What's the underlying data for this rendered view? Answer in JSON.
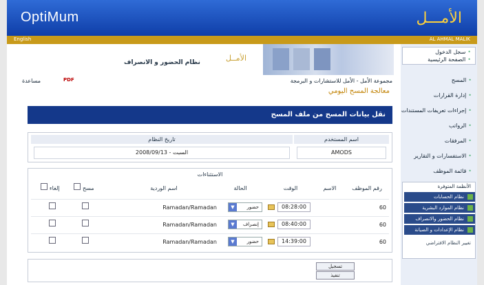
{
  "header": {
    "brand": "OptiMum",
    "logo_ar": "الأمـــل",
    "language_link": "English",
    "user": "AL AHMAL MALIK"
  },
  "hero": {
    "system_title": "نظام الحضور و الانصراف",
    "logo_small": "الأمــل"
  },
  "toolbar": {
    "help": "مساعدة",
    "pdf": "PDF",
    "breadcrumb": "مجموعة الأمل - الأمل للاستشارات و البرمجة"
  },
  "page": {
    "title": "معالجة المسح اليومي",
    "section_title": "نقل بيانات المسح من ملف المسح"
  },
  "info": {
    "user_label": "اسم المستخدم",
    "user_value": "AMODS",
    "system_date_label": "تاريخ النظام",
    "system_date_value": "2008/09/13 - السبت"
  },
  "grid": {
    "caption": "الاستثناءات",
    "headers": [
      "رقم الموظف",
      "الاسم",
      "الوقت",
      "الحالة",
      "اسم الوردية",
      "مسح",
      "إلغاء"
    ],
    "rows": [
      {
        "emp": "60",
        "time": "08:28:00",
        "status": "حضور",
        "shift": "Ramadan/Ramadan"
      },
      {
        "emp": "60",
        "time": "08:40:00",
        "status": "إنصراف",
        "shift": "Ramadan/Ramadan"
      },
      {
        "emp": "60",
        "time": "14:39:00",
        "status": "حضور",
        "shift": "Ramadan/Ramadan"
      }
    ]
  },
  "actions": {
    "save": "تسجيل",
    "process": "تنفيذ"
  },
  "sidebar": {
    "top_links": [
      "سجل الدخول",
      "الصفحة الرئيسية"
    ],
    "menu": [
      "المسح",
      "إدارة القرارات",
      "إجراءات تعريفات المستندات",
      "الرواتب",
      "المرفقات",
      "الاستفسارات و التقارير",
      "قائمة الموظف"
    ],
    "systems_header": "الأنظمة المتوفرة",
    "systems": [
      "نظام الحسابات",
      "نظام الموارد البشرية",
      "نظام الحضور والانصراف",
      "نظام الإعدادات و الصيانة"
    ],
    "footer": "تغيير النظام الافتراضي"
  }
}
